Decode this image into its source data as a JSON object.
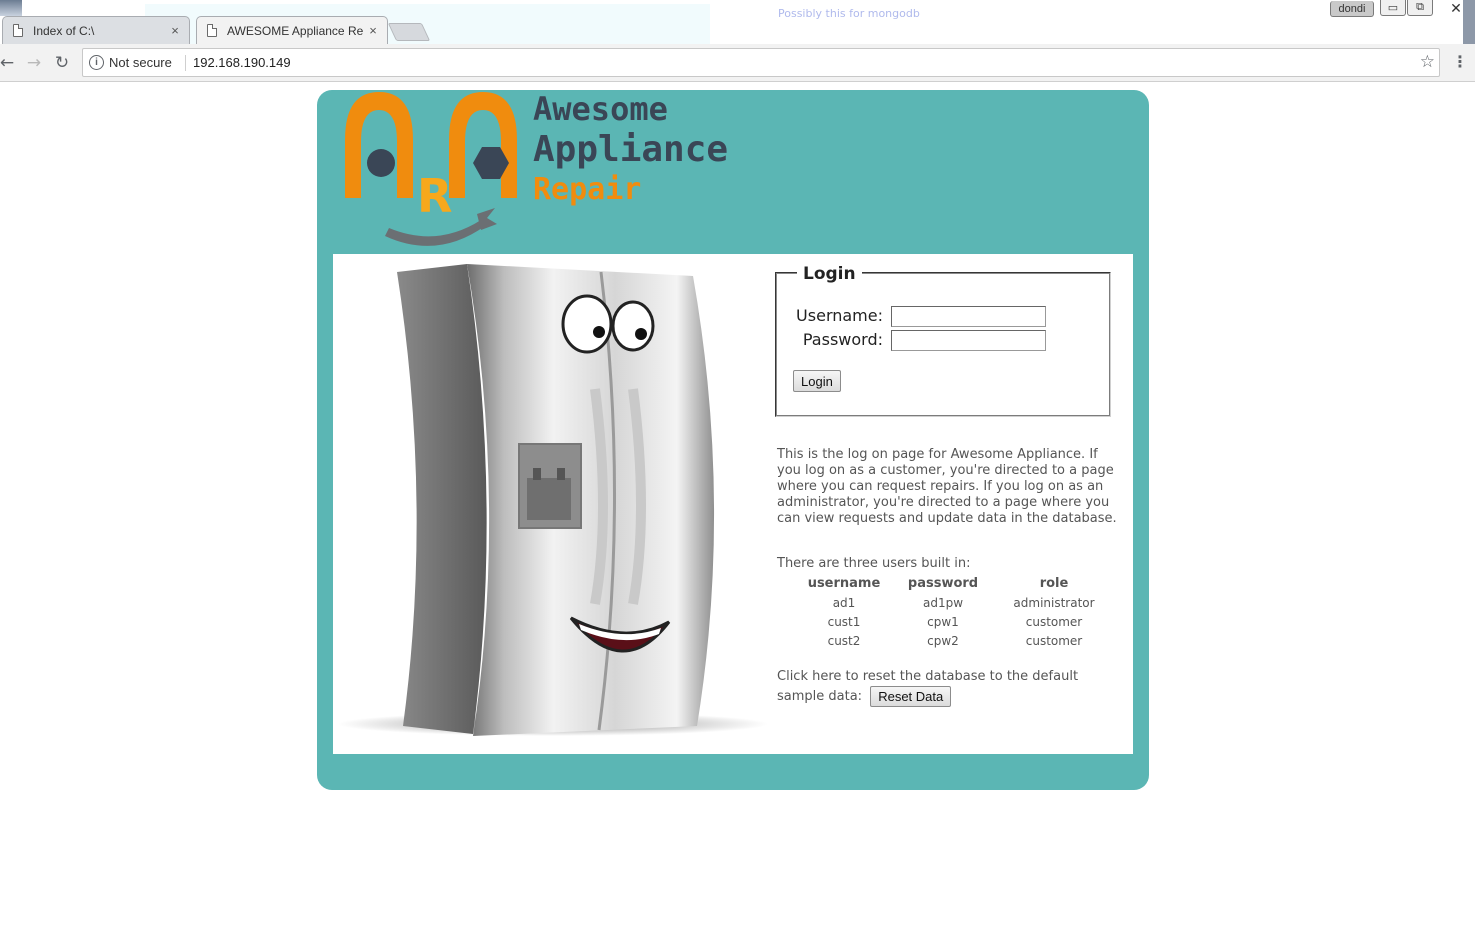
{
  "browser": {
    "tabs": [
      {
        "title": "Index of C:\\",
        "close": "×",
        "active": false
      },
      {
        "title": "AWESOME Appliance Re",
        "close": "×",
        "active": true
      }
    ],
    "background_text": "Possibly this for mongodb",
    "user_badge": "dondi",
    "window_buttons": {
      "minimize": "▭",
      "maximize": "⧉",
      "close": "✕"
    },
    "nav": {
      "back": "←",
      "forward": "→",
      "reload": "↻",
      "menu": "⋮",
      "star": "☆"
    },
    "address": {
      "info_icon": "i",
      "security": "Not secure",
      "url": "192.168.190.149"
    }
  },
  "logo": {
    "line1": "Awesome",
    "line2": "Appliance",
    "line3": "Repair",
    "monogram_r": "R",
    "colors": {
      "orange": "#f08c0e",
      "yellow": "#f7a81c",
      "dark": "#3a4656",
      "wrench": "#6b6f73"
    }
  },
  "login": {
    "legend": "Login",
    "username_label": "Username:",
    "password_label": "Password:",
    "username_value": "",
    "password_value": "",
    "button": "Login"
  },
  "description": "This is the log on page for Awesome Appliance. If you log on as a customer, you're directed to a page where you can request repairs. If you log on as an administrator, you're directed to a page where you can view requests and update data in the database.",
  "users": {
    "intro": "There are three users built in:",
    "headers": [
      "username",
      "password",
      "role"
    ],
    "rows": [
      [
        "ad1",
        "ad1pw",
        "administrator"
      ],
      [
        "cust1",
        "cpw1",
        "customer"
      ],
      [
        "cust2",
        "cpw2",
        "customer"
      ]
    ]
  },
  "reset": {
    "text": "Click here to reset the database to the default sample data:",
    "button": "Reset Data"
  },
  "colors": {
    "site_bg": "#5bb6b4",
    "text": "#555555"
  }
}
